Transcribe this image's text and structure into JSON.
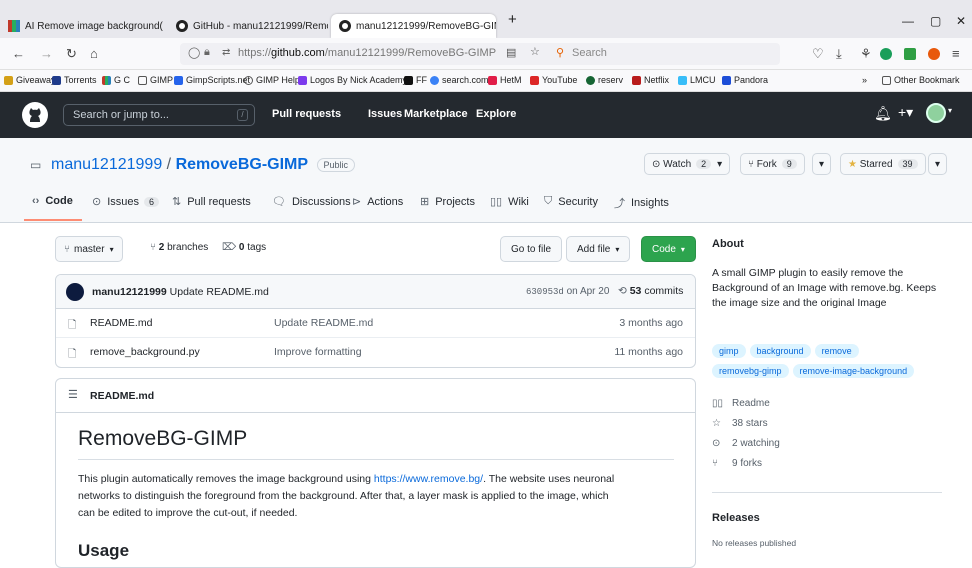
{
  "browser": {
    "tabs": [
      {
        "title": "AI Remove image background("
      },
      {
        "title": "GitHub - manu12121999/Remo"
      },
      {
        "title": "manu12121999/RemoveBG-GIM"
      }
    ],
    "url_prefix": "https://",
    "url_host": "github.com",
    "url_path": "/manu12121999/RemoveBG-GIMP",
    "search_placeholder": "Search",
    "bookmarks": [
      "Giveaway",
      "Torrents",
      "G C",
      "GIMP",
      "GimpScripts.net",
      "GIMP Help",
      "Logos By Nick Academy",
      "FF",
      "search.com",
      "HetM",
      "YouTube",
      "reserv",
      "Netflix",
      "LMCU",
      "Pandora",
      "Other Bookmark"
    ]
  },
  "github": {
    "search_placeholder": "Search or jump to...",
    "search_key": "/",
    "nav": [
      "Pull requests",
      "Issues",
      "Marketplace",
      "Explore"
    ]
  },
  "repo": {
    "owner": "manu12121999",
    "sep": "/",
    "name": "RemoveBG-GIMP",
    "visibility": "Public",
    "watch_label": "Watch",
    "watch_count": "2",
    "fork_label": "Fork",
    "fork_count": "9",
    "star_label": "Starred",
    "star_count": "39",
    "tabs": [
      {
        "label": "Code",
        "count": ""
      },
      {
        "label": "Issues",
        "count": "6"
      },
      {
        "label": "Pull requests",
        "count": ""
      },
      {
        "label": "Discussions",
        "count": ""
      },
      {
        "label": "Actions",
        "count": ""
      },
      {
        "label": "Projects",
        "count": ""
      },
      {
        "label": "Wiki",
        "count": ""
      },
      {
        "label": "Security",
        "count": ""
      },
      {
        "label": "Insights",
        "count": ""
      }
    ]
  },
  "toolbar": {
    "branch": "master",
    "branches_count": "2",
    "branches_label": "branches",
    "tags_count": "0",
    "tags_label": "tags",
    "goto_file": "Go to file",
    "add_file": "Add file",
    "code": "Code"
  },
  "commit": {
    "author": "manu12121999",
    "message": "Update README.md",
    "hash": "630953d",
    "date": "on Apr 20",
    "count": "53",
    "count_label": "commits"
  },
  "files": [
    {
      "name": "README.md",
      "message": "Update README.md",
      "age": "3 months ago"
    },
    {
      "name": "remove_background.py",
      "message": "Improve formatting",
      "age": "11 months ago"
    }
  ],
  "readme": {
    "filename": "README.md",
    "title": "RemoveBG-GIMP",
    "p1_start": "This plugin automatically removes the image background using ",
    "p1_link": "https://www.remove.bg/",
    "p1_end": ". The website uses neuronal",
    "p2": "networks to distinguish the foreground from the background. After that, a layer mask is applied to the image, which",
    "p3": "can be edited to improve the cut-out, if needed.",
    "usage": "Usage"
  },
  "about": {
    "title": "About",
    "description": "A small GIMP plugin to easily remove the Background of an Image with remove.bg. Keeps the image size and the original Image",
    "topics": [
      "gimp",
      "background",
      "remove",
      "removebg-gimp",
      "remove-image-background"
    ],
    "readme": "Readme",
    "stars": "38 stars",
    "watching": "2 watching",
    "forks": "9 forks",
    "releases_title": "Releases",
    "releases_text": "No releases published"
  },
  "colors": {
    "header": "#24292f",
    "link": "#0969da",
    "code_button": "#2da44e",
    "tab_underline": "#fd8c73"
  }
}
